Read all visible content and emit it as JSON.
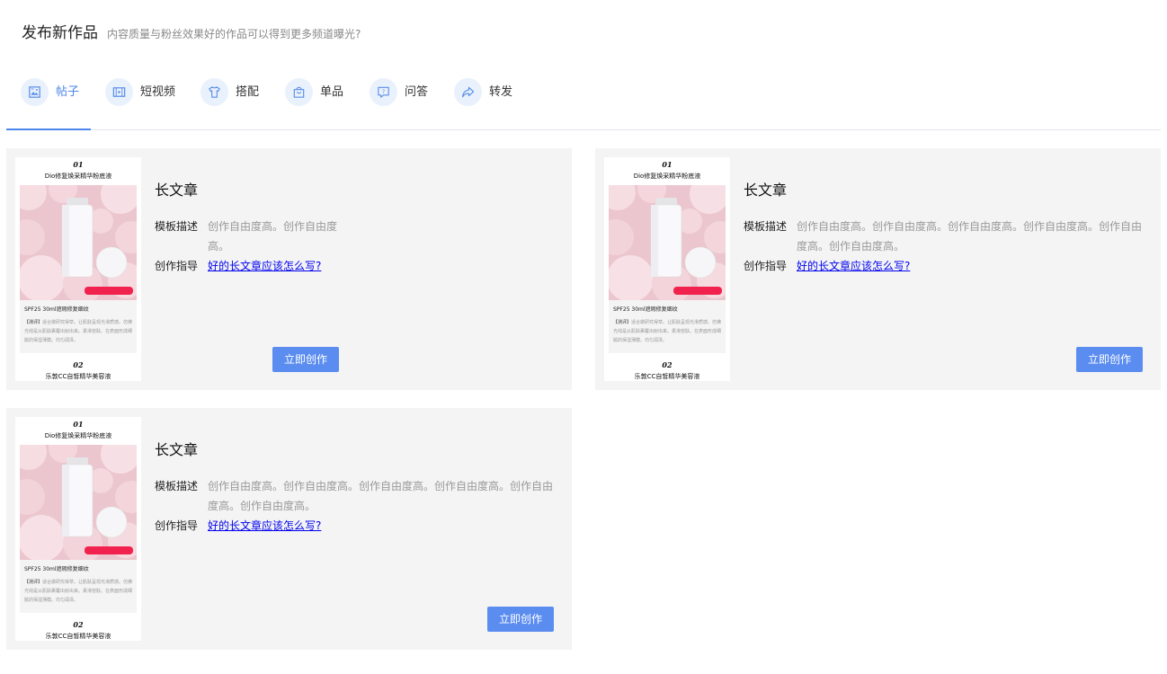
{
  "header": {
    "title": "发布新作品",
    "subtitle": "内容质量与粉丝效果好的作品可以得到更多频道曝光?"
  },
  "tabs": [
    {
      "label": "帖子",
      "icon": "image-post-icon"
    },
    {
      "label": "短视频",
      "icon": "video-icon"
    },
    {
      "label": "搭配",
      "icon": "tshirt-icon"
    },
    {
      "label": "单品",
      "icon": "shopping-bag-icon"
    },
    {
      "label": "问答",
      "icon": "qa-chat-icon"
    },
    {
      "label": "转发",
      "icon": "share-arrow-icon"
    }
  ],
  "active_tab": "帖子",
  "accent_color": "#4f86ec",
  "thumbnail": {
    "num1": "01",
    "product1": "Dio修复焕采精华粉底液",
    "desc_title": "SPF25 30ml遮瑕修复细纹",
    "desc_prefix": "【测评】",
    "desc_text": "适合做研究得草。让肌肤呈现光滑质感。仿佛光线是从肌肤裹覆出射出来。柔滑容肤。在表面形成细腻的保湿薄膜。均匀润泽。",
    "price_tag": "¥580.00 | 查看详情",
    "num2": "02",
    "product2": "乐敦CC自皙精华美容液"
  },
  "cards": [
    {
      "title": "长文章",
      "desc_label": "模板描述",
      "desc_line1": "创作自由度高。创作自由度",
      "desc_line2": "高。",
      "guide_label": "创作指导",
      "guide_link": "好的长文章应该怎么写?",
      "button": "立即创作"
    },
    {
      "title": "长文章",
      "desc_label": "模板描述",
      "desc_line1": "创作自由度高。创作自由度高。创作自由度高。创作自由度高。创作自由",
      "desc_line2": "度高。创作自由度高。",
      "guide_label": "创作指导",
      "guide_link": "好的长文章应该怎么写?",
      "button": "立即创作"
    },
    {
      "title": "长文章",
      "desc_label": "模板描述",
      "desc_line1": "创作自由度高。创作自由度高。创作自由度高。创作自由度高。创作自由",
      "desc_line2": "度高。创作自由度高。",
      "guide_label": "创作指导",
      "guide_link": "好的长文章应该怎么写?",
      "button": "立即创作"
    }
  ]
}
